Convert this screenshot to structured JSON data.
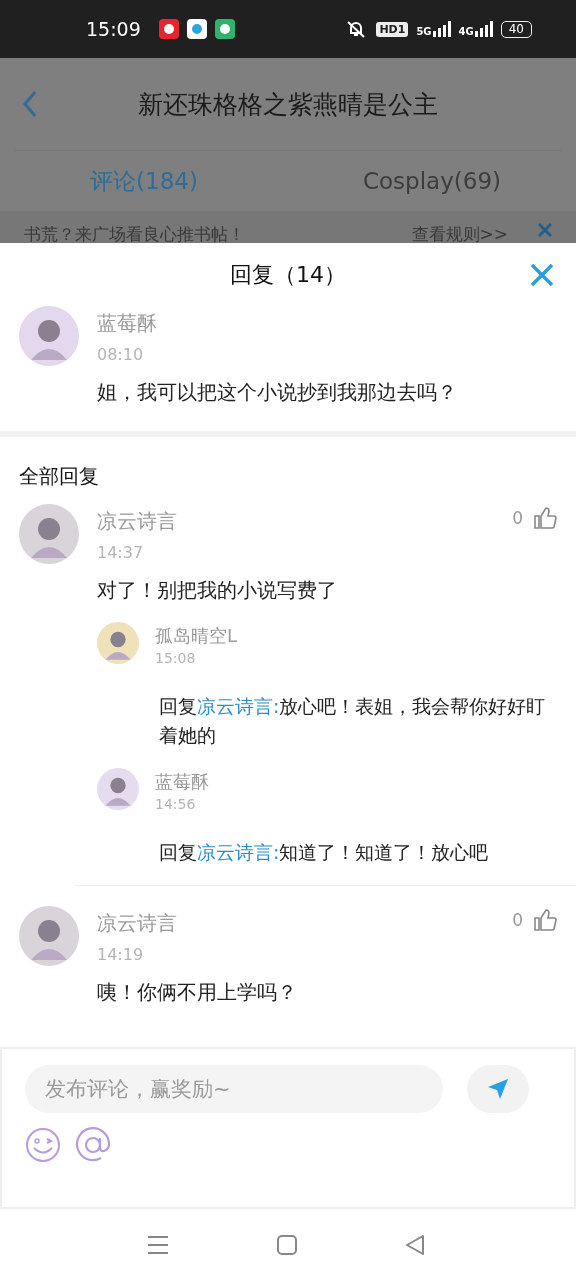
{
  "status_bar": {
    "time": "15:09",
    "hd": "HD1",
    "networks": [
      "5G",
      "4G"
    ],
    "battery": "40"
  },
  "header": {
    "title": "新还珠格格之紫燕晴是公主"
  },
  "tabs": [
    {
      "label": "评论(184)",
      "selected": true
    },
    {
      "label": "Cosplay(69)",
      "selected": false
    }
  ],
  "banner": {
    "text": "书荒？来广场看良心推书帖！",
    "link": "查看规则>>"
  },
  "sheet": {
    "title": "回复（14）",
    "original": {
      "name": "蓝莓酥",
      "time": "08:10",
      "text": "姐，我可以把这个小说抄到我那边去吗？"
    },
    "section_title": "全部回复",
    "comments": [
      {
        "name": "凉云诗言",
        "time": "14:37",
        "likes": "0",
        "text": "对了！别把我的小说写费了",
        "replies": [
          {
            "name": "孤岛晴空L",
            "time": "15:08",
            "prefix": "回复",
            "target": "凉云诗言:",
            "text": "放心吧！表姐，我会帮你好好盯着她的"
          },
          {
            "name": "蓝莓酥",
            "time": "14:56",
            "prefix": "回复",
            "target": "凉云诗言:",
            "text": "知道了！知道了！放心吧"
          }
        ]
      },
      {
        "name": "凉云诗言",
        "time": "14:19",
        "likes": "0",
        "text": "咦！你俩不用上学吗？"
      }
    ]
  },
  "composer": {
    "placeholder": "发布评论，赢奖励~"
  }
}
